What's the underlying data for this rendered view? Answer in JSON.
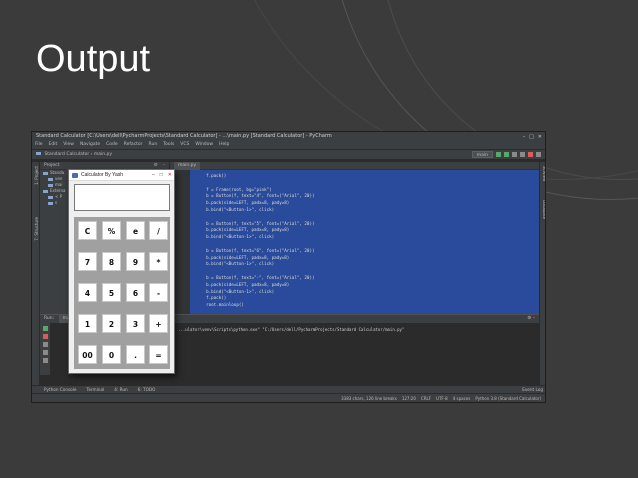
{
  "slide": {
    "title": "Output"
  },
  "ide": {
    "window_title": "Standard Calculator [C:\\Users\\dell\\PycharmProjects\\Standard Calculator] - ...\\main.py [Standard Calculator] - PyCharm",
    "menu": [
      "File",
      "Edit",
      "View",
      "Navigate",
      "Code",
      "Refactor",
      "Run",
      "Tools",
      "VCS",
      "Window",
      "Help"
    ],
    "breadcrumb_project": "Standard Calculator",
    "breadcrumb_file": "main.py",
    "run_config": "main",
    "project_label": "Project",
    "editor_tab": "main.py",
    "code_lines": [
      "    f.pack()",
      "",
      "    f = Frame(root, bg=\"pink\")",
      "    b = Button(f, text=\"4\", font=(\"Arial\", 20))",
      "    b.pack(side=LEFT, padx=8, pady=8)",
      "    b.bind(\"<Button-1>\", click)",
      "",
      "    b = Button(f, text=\"5\", font=(\"Arial\", 20))",
      "    b.pack(side=LEFT, padx=8, pady=8)",
      "    b.bind(\"<Button-1>\", click)",
      "",
      "    b = Button(f, text=\"6\", font=(\"Arial\", 20))",
      "    b.pack(side=LEFT, padx=8, pady=8)",
      "    b.bind(\"<Button-1>\", click)",
      "",
      "    b = Button(f, text=\"-\", font=(\"Arial\", 20))",
      "    b.pack(side=LEFT, padx=8, pady=8)",
      "    b.bind(\"<Button-1>\", click)",
      "    f.pack()",
      "    root.mainloop()"
    ],
    "run_label": "Run:",
    "run_tab": "main",
    "run_output": "...ulator\\venv\\Scripts\\python.exe\" \"C:/Users/dell/PycharmProjects/Standard Calculator/main.py\"",
    "bottom_tabs": [
      "Python Console",
      "Terminal",
      "4: Run",
      "6: TODO"
    ],
    "event_log": "Event Log",
    "status": [
      "3383 chars, 126 line breaks",
      "127:20",
      "CRLF",
      "UTF-8",
      "4 spaces",
      "Python 3.8 (Standard Calculator)"
    ]
  },
  "calculator": {
    "title": "Calculator By Yash",
    "display_value": "",
    "rows": [
      [
        "C",
        "%",
        "e",
        "/"
      ],
      [
        "7",
        "8",
        "9",
        "*"
      ],
      [
        "4",
        "5",
        "6",
        "-"
      ],
      [
        "1",
        "2",
        "3",
        "+"
      ],
      [
        "00",
        "0",
        ".",
        "="
      ]
    ]
  }
}
